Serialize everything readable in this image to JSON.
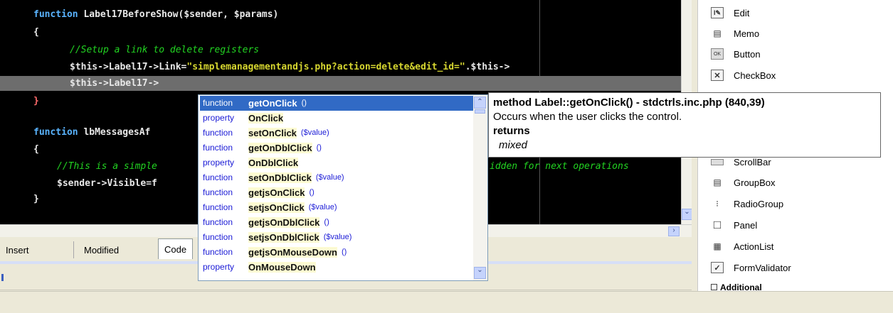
{
  "colors": {
    "editor_bg": "#000000",
    "keyword": "#5ab4ff",
    "string": "#d6d630",
    "comment": "#22d322",
    "selection": "#316ac5",
    "kind_text": "#1a1ad6"
  },
  "editor": {
    "line1": {
      "kw": "function",
      "rest": " Label17BeforeShow($sender, $params)"
    },
    "line2": "{",
    "line3": "//Setup a link to delete registers",
    "line4": {
      "pre": "$this->Label17->Link=",
      "str": "\"simplemanagementandjs.php?action=delete&edit_id=\"",
      "post": ".$this->"
    },
    "line5": "$this->Label17->",
    "line6": "}",
    "line7": {
      "kw": "function",
      "rest": " lbMessagesAf"
    },
    "line8": "{",
    "line9a": "//This is a simple",
    "line9b": "idden for next operations",
    "line10": "$sender->Visible=f",
    "line11": "}"
  },
  "tabs": {
    "insert": "Insert",
    "modified": "Modified",
    "code": "Code"
  },
  "palette": {
    "items": [
      {
        "label": "Edit",
        "icon": "edit-icon"
      },
      {
        "label": "Memo",
        "icon": "memo-icon"
      },
      {
        "label": "Button",
        "icon": "button-icon"
      },
      {
        "label": "CheckBox",
        "icon": "checkbox-icon"
      },
      {
        "label": "ScrollBar",
        "icon": "scrollbar-icon"
      },
      {
        "label": "GroupBox",
        "icon": "groupbox-icon"
      },
      {
        "label": "RadioGroup",
        "icon": "radiogroup-icon"
      },
      {
        "label": "Panel",
        "icon": "panel-icon"
      },
      {
        "label": "ActionList",
        "icon": "actionlist-icon"
      },
      {
        "label": "FormValidator",
        "icon": "formvalidator-icon"
      }
    ],
    "group_label": "Additional"
  },
  "popup": {
    "items": [
      {
        "kind": "function",
        "name": "getOnClick",
        "args": "()"
      },
      {
        "kind": "property",
        "name": "OnClick",
        "args": ""
      },
      {
        "kind": "function",
        "name": "setOnClick",
        "args": "($value)"
      },
      {
        "kind": "function",
        "name": "getOnDblClick",
        "args": "()"
      },
      {
        "kind": "property",
        "name": "OnDblClick",
        "args": ""
      },
      {
        "kind": "function",
        "name": "setOnDblClick",
        "args": "($value)"
      },
      {
        "kind": "function",
        "name": "getjsOnClick",
        "args": "()"
      },
      {
        "kind": "function",
        "name": "setjsOnClick",
        "args": "($value)"
      },
      {
        "kind": "function",
        "name": "getjsOnDblClick",
        "args": "()"
      },
      {
        "kind": "function",
        "name": "setjsOnDblClick",
        "args": "($value)"
      },
      {
        "kind": "function",
        "name": "getjsOnMouseDown",
        "args": "()"
      },
      {
        "kind": "property",
        "name": "OnMouseDown",
        "args": ""
      }
    ]
  },
  "tooltip": {
    "signature": "method Label::getOnClick() - stdctrls.inc.php (840,39)",
    "description": "Occurs when the user clicks the control.",
    "returns_label": "returns",
    "returns_type": "mixed"
  }
}
